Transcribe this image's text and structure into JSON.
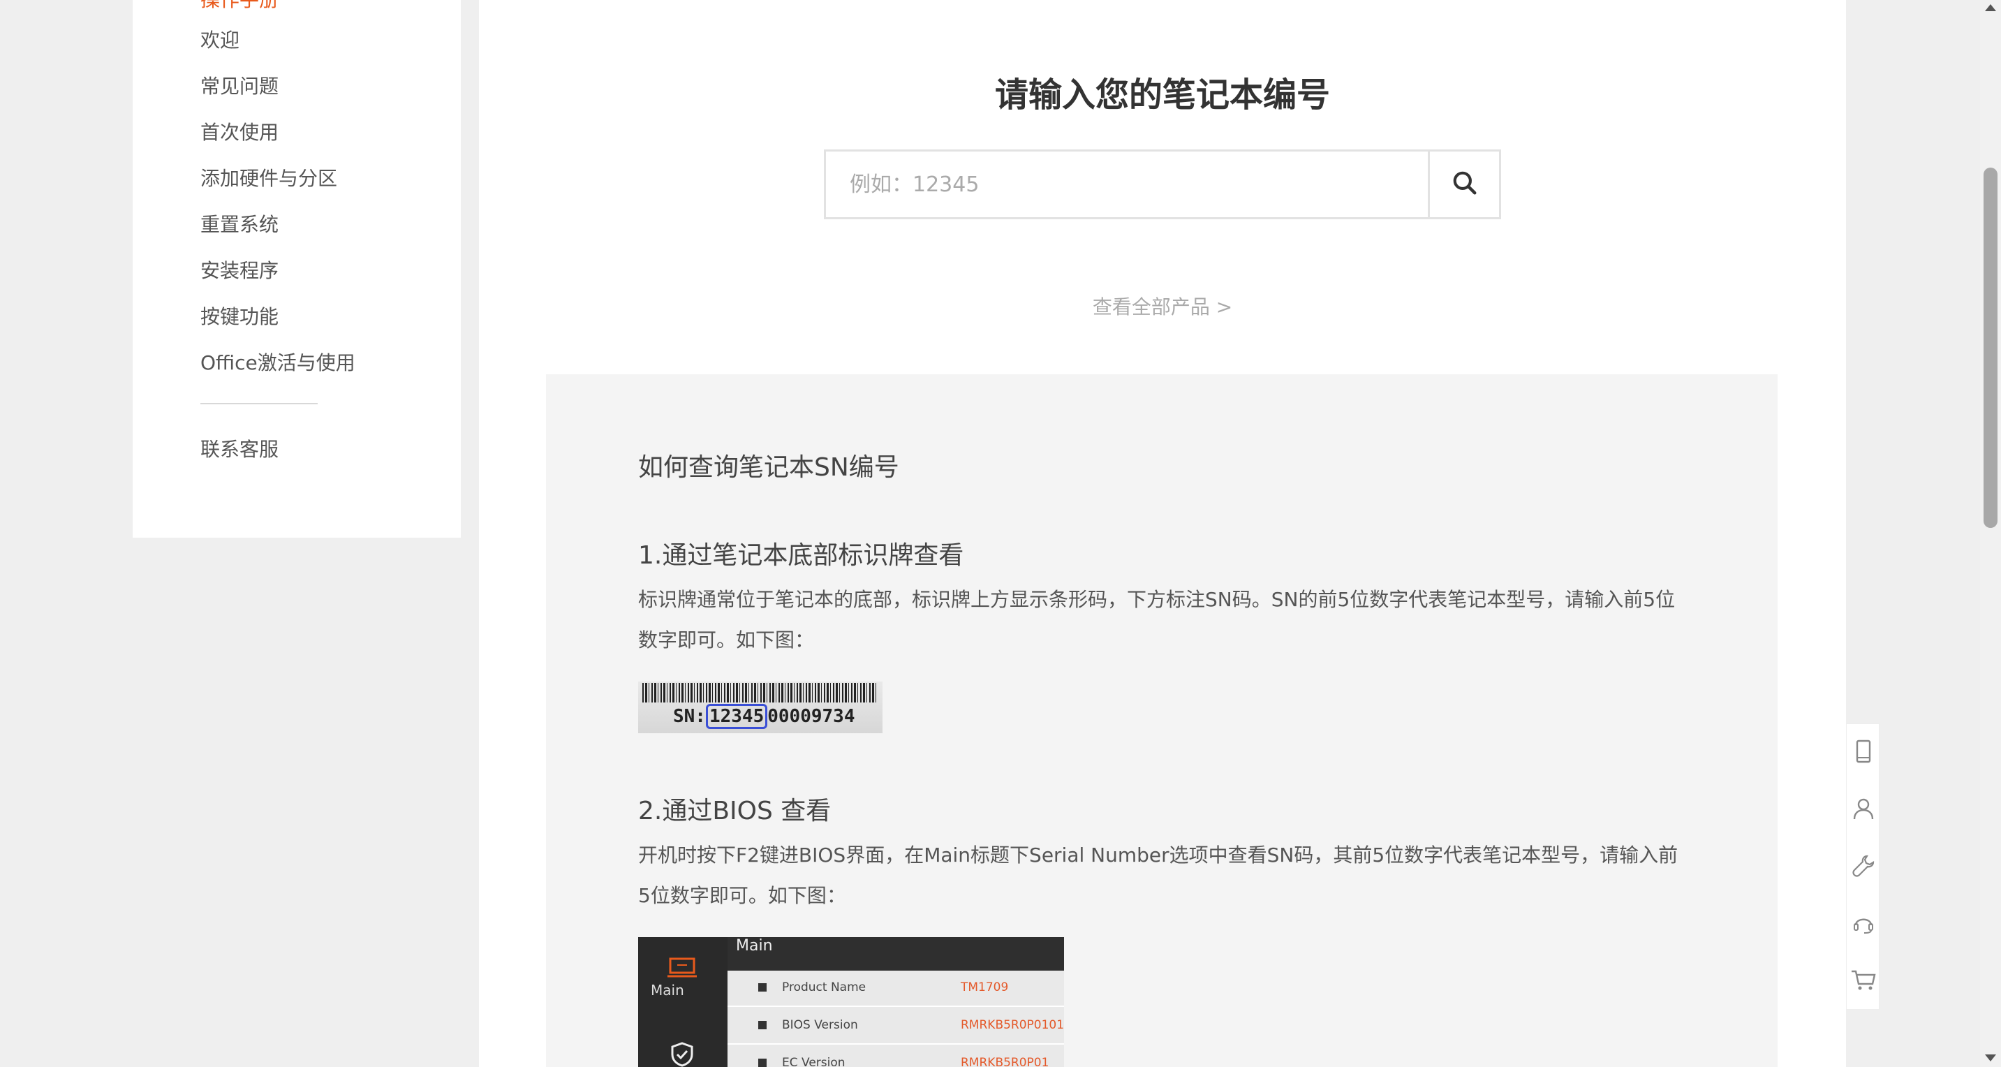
{
  "sidebar": {
    "partial_label": "操作手册",
    "items": [
      {
        "label": "欢迎"
      },
      {
        "label": "常见问题"
      },
      {
        "label": "首次使用"
      },
      {
        "label": "添加硬件与分区"
      },
      {
        "label": "重置系统"
      },
      {
        "label": "安装程序"
      },
      {
        "label": "按键功能"
      },
      {
        "label": "Office激活与使用"
      }
    ],
    "contact": "联系客服"
  },
  "main": {
    "title": "请输入您的笔记本编号",
    "search": {
      "placeholder": "例如：12345",
      "value": ""
    },
    "view_all": "查看全部产品 >",
    "howto": {
      "heading": "如何查询笔记本SN编号",
      "step1_title": "1.通过笔记本底部标识牌查看",
      "step1_text": "标识牌通常位于笔记本的底部，标识牌上方显示条形码，下方标注SN码。SN的前5位数字代表笔记本型号，请输入前5位数字即可。如下图：",
      "barcode": {
        "prefix": "SN:",
        "highlight": "12345",
        "rest": "00009734"
      },
      "step2_title": "2.通过BIOS 查看",
      "step2_text": "开机时按下F2键进BIOS界面，在Main标题下Serial Number选项中查看SN码，其前5位数字代表笔记本型号，请输入前5位数字即可。如下图：",
      "bios": {
        "header": "Main",
        "side_label": "Main",
        "rows": [
          {
            "key": "Product Name",
            "value": "TM1709"
          },
          {
            "key": "BIOS Version",
            "value": "RMRKB5R0P0101"
          },
          {
            "key": "EC Version",
            "value": "RMRKB5R0P01"
          }
        ]
      }
    }
  },
  "floating_toolbar": [
    "tablet-icon",
    "user-icon",
    "wrench-icon",
    "headset-icon",
    "cart-icon"
  ],
  "colors": {
    "accent": "#e85a1c",
    "bios_value": "#e4592a",
    "highlight": "#3a4fd6"
  }
}
